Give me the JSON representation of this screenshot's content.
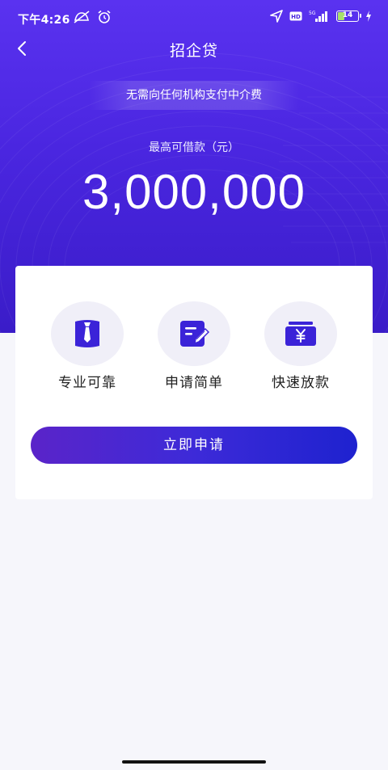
{
  "status_bar": {
    "time": "下午4:26",
    "battery_level": "14"
  },
  "nav": {
    "title": "招企贷"
  },
  "hero": {
    "notice": "无需向任何机构支付中介费",
    "limit_label": "最高可借款（元）",
    "limit_amount": "3,000,000"
  },
  "features": [
    {
      "label": "专业可靠",
      "icon": "shield-tie-icon"
    },
    {
      "label": "申请简单",
      "icon": "edit-document-icon"
    },
    {
      "label": "快速放款",
      "icon": "yen-wallet-icon"
    }
  ],
  "apply_button": {
    "label": "立即申请"
  },
  "colors": {
    "brand_primary": "#4a26e0",
    "icon_purple": "#3b23d8",
    "feature_bg": "#f0eff8",
    "page_bg": "#f6f6fb"
  }
}
